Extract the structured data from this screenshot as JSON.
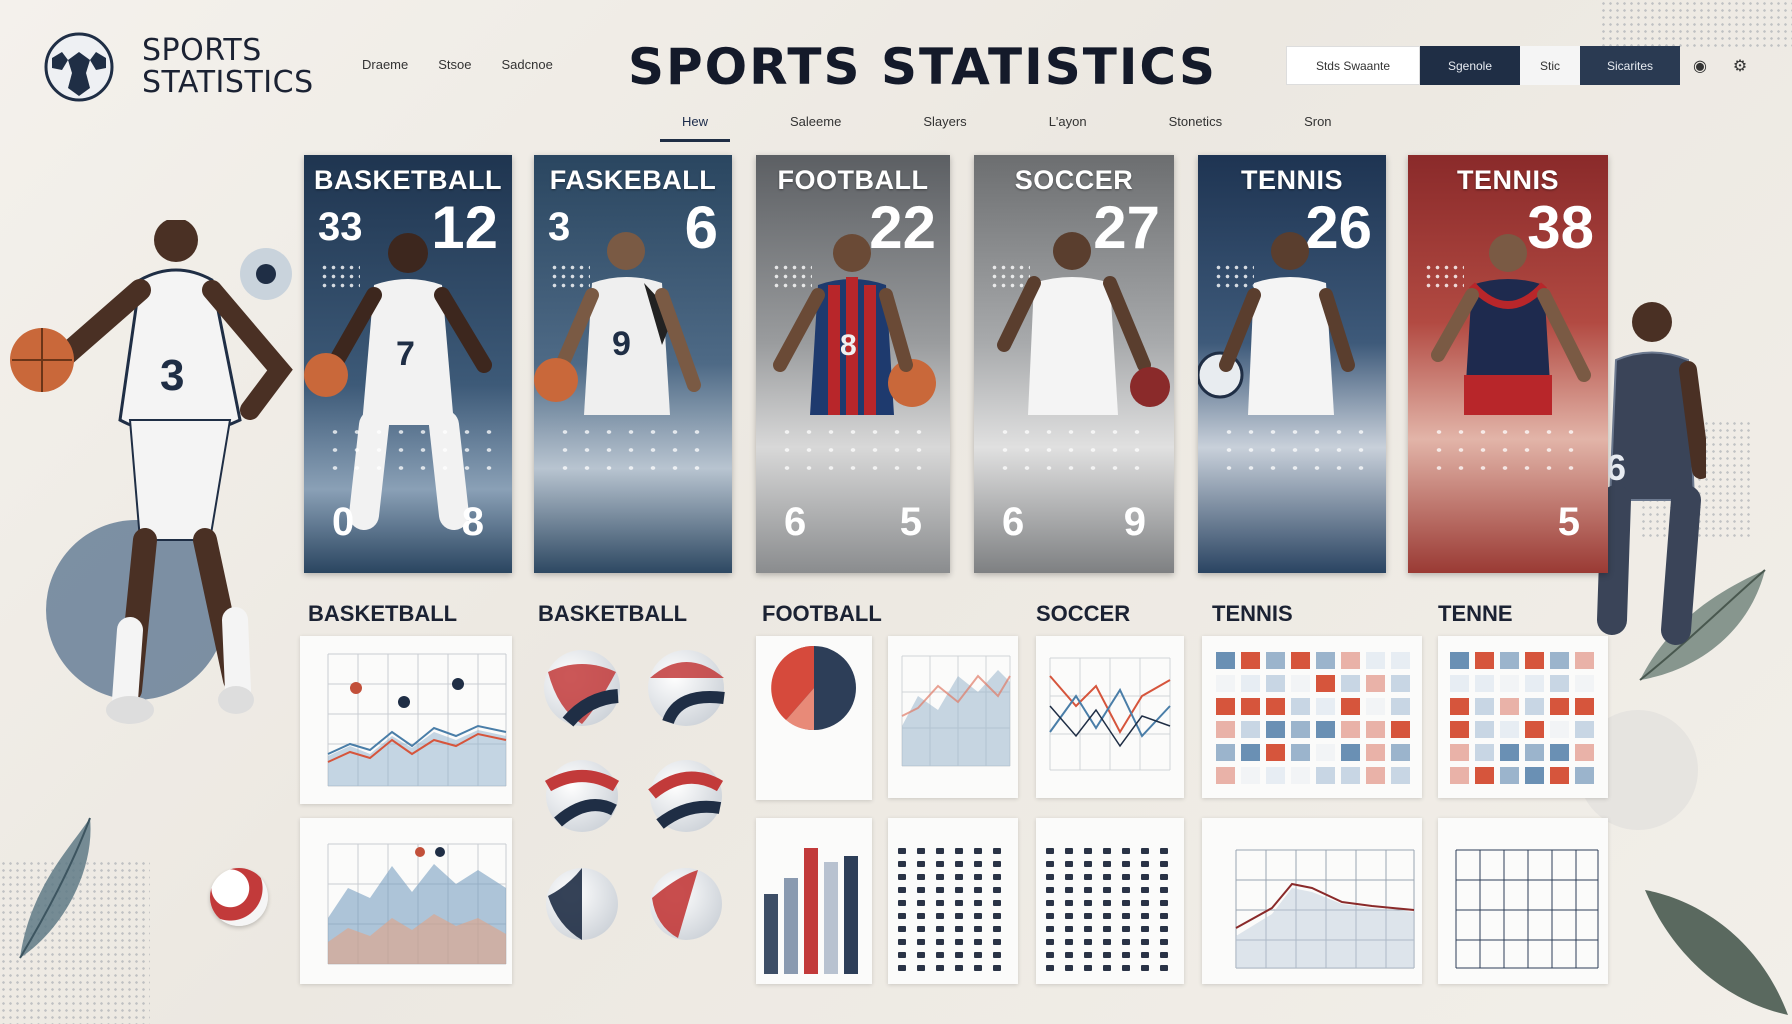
{
  "header": {
    "logo_line1": "SPORTS",
    "logo_line2": "STATISTICS",
    "links": [
      "Draeme",
      "Stsoe",
      "Sadcnoe"
    ],
    "title": "SPORTS STATISTICS",
    "toolbar": {
      "search_label": "Stds Swaante",
      "btn1": "Sgenole",
      "btn2": "Stic",
      "btn3": "Sicarites"
    }
  },
  "nav": {
    "tabs": [
      "Hew",
      "Saleeme",
      "Slayers",
      "L'ayon",
      "Stonetics",
      "Sron"
    ],
    "active_index": 0
  },
  "cards": [
    {
      "title": "BASKETBALL",
      "num_left": "33",
      "num_right": "12",
      "bottom_left": "0",
      "bottom_right": "8",
      "jersey": "7",
      "theme": "#1f3550"
    },
    {
      "title": "FASKEBALL",
      "num_left": "3",
      "num_right": "6",
      "bottom_left": "",
      "bottom_right": "",
      "jersey": "9",
      "theme": "#2a4660"
    },
    {
      "title": "FOOTBALL",
      "num_left": "",
      "num_right": "22",
      "bottom_left": "6",
      "bottom_right": "5",
      "jersey": "8",
      "theme": "#7b7d80"
    },
    {
      "title": "SOCCER",
      "num_left": "",
      "num_right": "27",
      "bottom_left": "6",
      "bottom_right": "9",
      "jersey": "",
      "theme": "#8a8c8e"
    },
    {
      "title": "TENNIS",
      "num_left": "",
      "num_right": "26",
      "bottom_left": "",
      "bottom_right": "",
      "jersey": "",
      "theme": "#1e3452"
    },
    {
      "title": "TENNIS",
      "num_left": "",
      "num_right": "38",
      "bottom_left": "",
      "bottom_right": "5",
      "jersey": "",
      "theme": "#8a2a2a"
    }
  ],
  "sections": [
    "BASKETBALL",
    "BASKETBALL",
    "FOOTBALL",
    "SOCCER",
    "TENNIS",
    "TENNE"
  ],
  "side_players": {
    "left_jersey": "3",
    "right_jersey": "6"
  },
  "colors": {
    "navy": "#1f2e45",
    "red": "#c23a3a",
    "blue": "#4a7ea8"
  }
}
